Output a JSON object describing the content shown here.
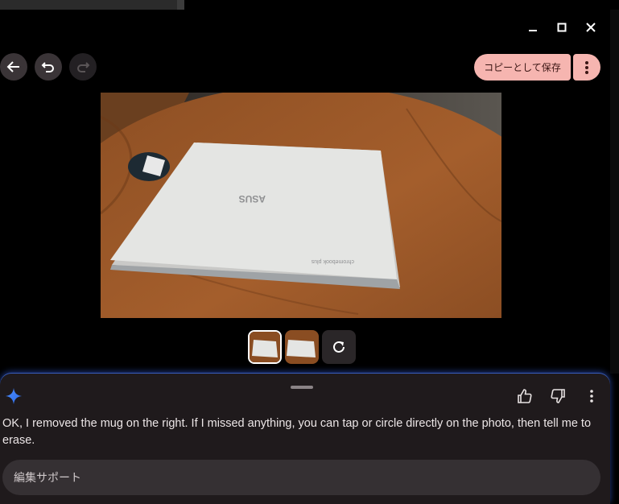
{
  "window": {
    "minimize_icon": "minimize-icon",
    "maximize_icon": "maximize-icon",
    "close_icon": "close-icon"
  },
  "toolbar": {
    "back_icon": "arrow-left-icon",
    "undo_icon": "undo-icon",
    "redo_icon": "redo-icon",
    "save_label": "コピーとして保存",
    "more_icon": "more-vert-icon"
  },
  "thumbnails": [
    {
      "selected": true
    },
    {
      "selected": false
    }
  ],
  "refresh_icon": "refresh-icon",
  "panel": {
    "assistant_icon": "sparkle-icon",
    "thumbs_up_icon": "thumb-up-icon",
    "thumbs_down_icon": "thumb-down-icon",
    "more_icon": "more-vert-icon",
    "message": "OK, I removed the mug on the right. If I missed anything, you can tap or circle directly on the photo, then tell me to erase.",
    "input_placeholder": "編集サポート"
  },
  "colors": {
    "accent": "#f6b5b0",
    "panel_bg": "#1f1a1c",
    "sparkle": "#4a8cff"
  }
}
